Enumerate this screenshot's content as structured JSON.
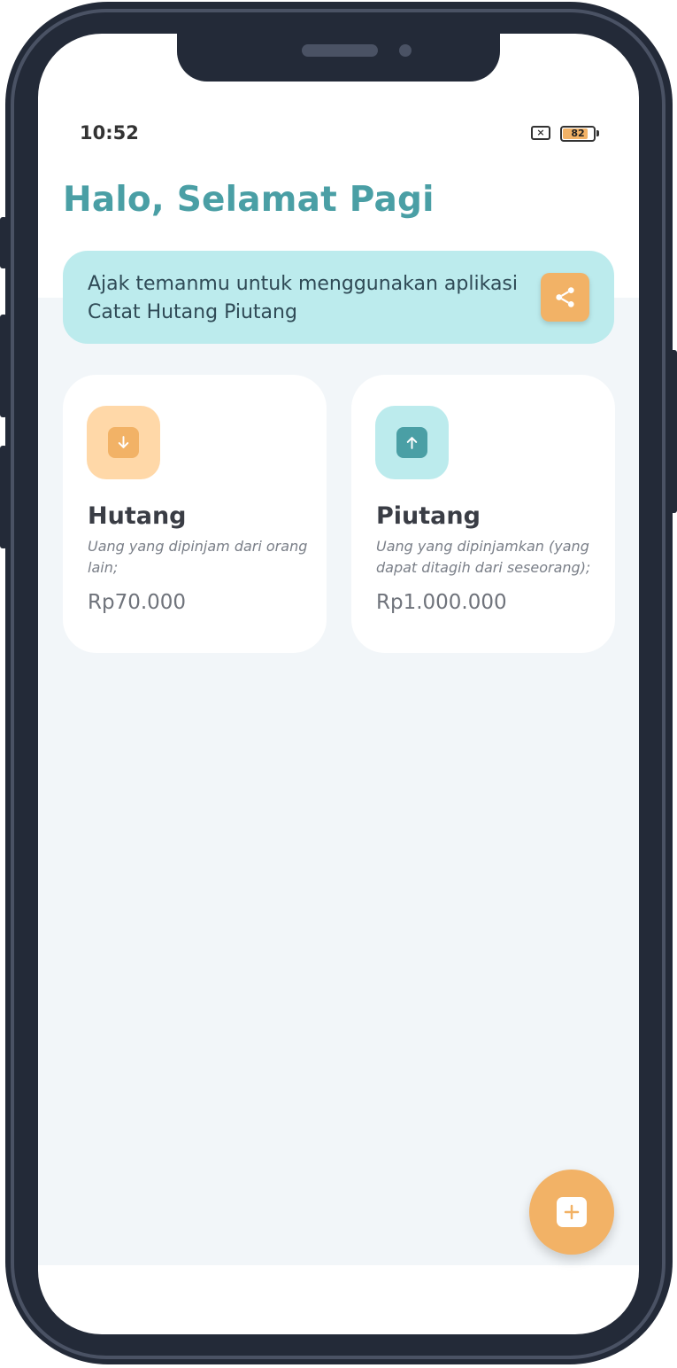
{
  "status_bar": {
    "time": "10:52",
    "sim_icon": "sim-off-icon",
    "battery_level": 82,
    "battery_label": "82"
  },
  "header": {
    "greeting": "Halo, Selamat Pagi"
  },
  "banner": {
    "text": "Ajak temanmu untuk menggunakan aplikasi Catat Hutang Piutang",
    "share_icon": "share-icon"
  },
  "cards": [
    {
      "title": "Hutang",
      "description": "Uang yang dipinjam dari orang lain;",
      "amount": "Rp70.000",
      "icon": "arrow-down-icon"
    },
    {
      "title": "Piutang",
      "description": "Uang yang dipinjamkan (yang dapat ditagih dari seseorang);",
      "amount": "Rp1.000.000",
      "icon": "arrow-up-icon"
    }
  ],
  "fab": {
    "icon": "plus-icon"
  },
  "colors": {
    "accent_orange": "#f2b266",
    "accent_teal": "#4a9fa5",
    "banner_bg": "#bcebed",
    "hutang_icon_bg": "#ffd8a8",
    "piutang_icon_bg": "#bcebed",
    "phone_frame": "#232a38"
  }
}
